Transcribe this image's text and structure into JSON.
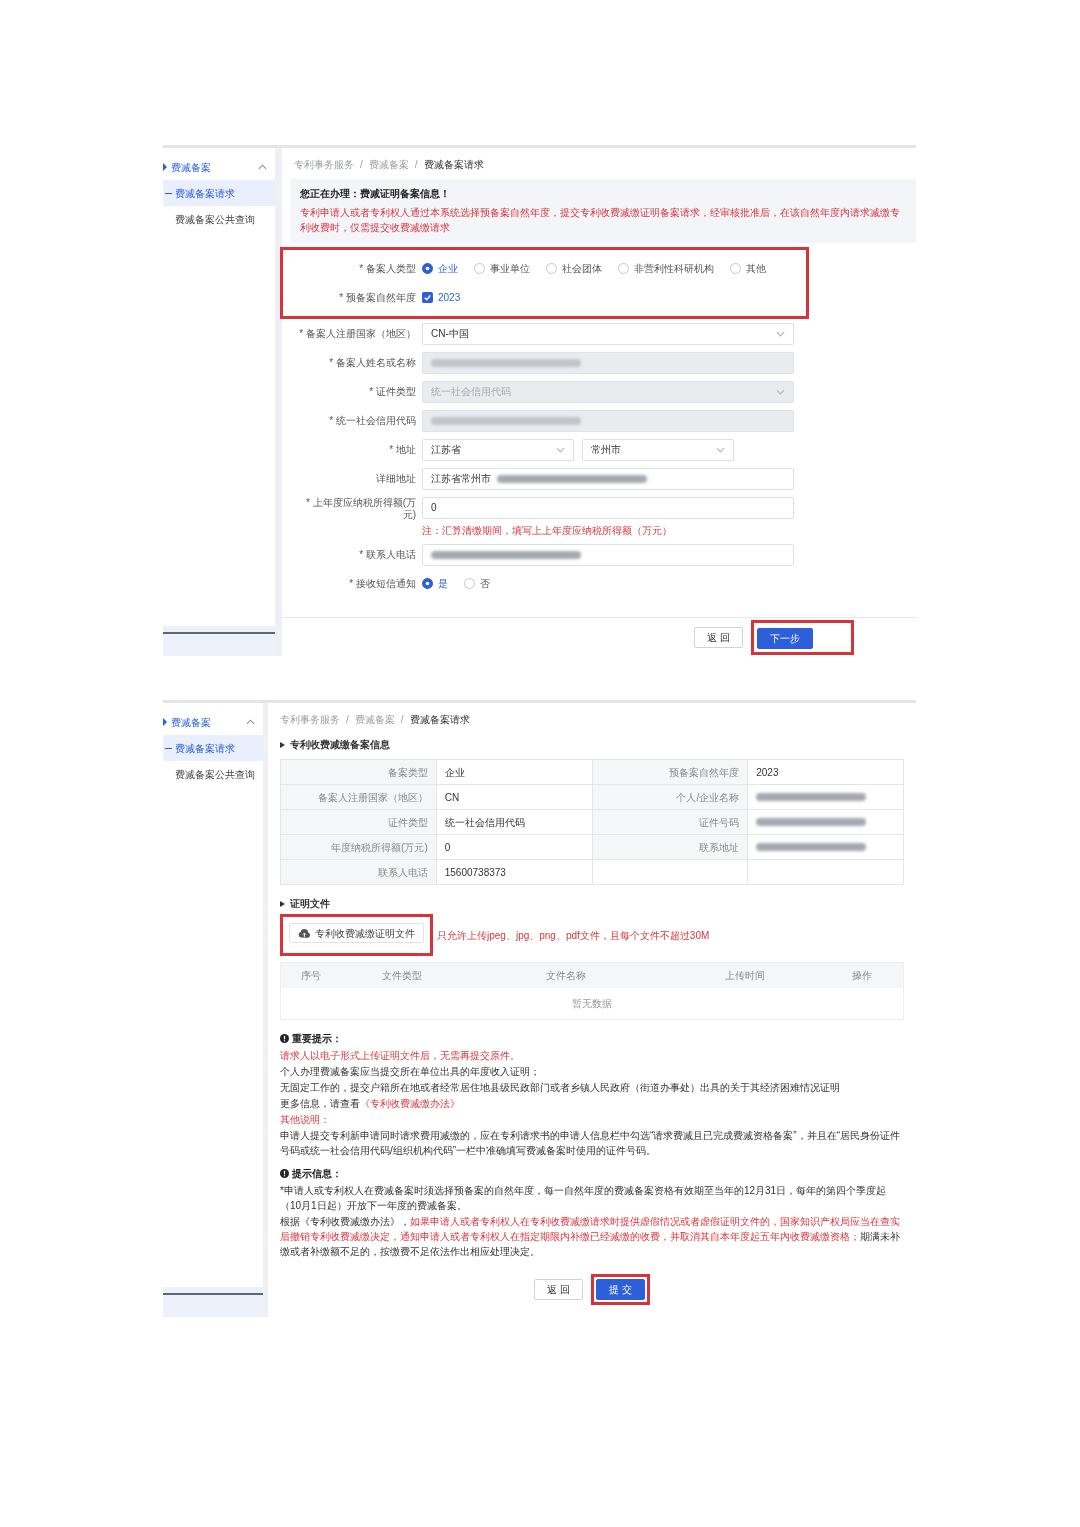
{
  "form_page": {
    "sidebar": {
      "items": [
        {
          "label": "费减备案",
          "selected": true,
          "expanded": true,
          "children": [
            {
              "label": "费减备案请求",
              "selected": true
            },
            {
              "label": "费减备案公共查询",
              "selected": false
            }
          ]
        }
      ]
    },
    "breadcrumb": {
      "separator": "/",
      "items": [
        "专利事务服务",
        "费减备案",
        "费减备案请求"
      ]
    },
    "notice": {
      "title": "您正在办理：费减证明备案信息！",
      "text": "专利申请人或者专利权人通过本系统选择预备案自然年度，提交专利收费减缴证明备案请求，经审核批准后，在该自然年度内请求减缴专利收费时，仅需提交收费减缴请求"
    },
    "fields": [
      {
        "kind": "radio",
        "label": "* 备案人类型",
        "highlighted": true,
        "options": [
          {
            "label": "企业",
            "selected": true
          },
          {
            "label": "事业单位",
            "selected": false
          },
          {
            "label": "社会团体",
            "selected": false
          },
          {
            "label": "非营利性科研机构",
            "selected": false
          },
          {
            "label": "其他",
            "selected": false
          }
        ]
      },
      {
        "kind": "checkbox",
        "label": "* 预备案自然年度",
        "highlighted": true,
        "options": [
          {
            "label": "2023",
            "checked": true
          }
        ]
      },
      {
        "kind": "select",
        "label": "* 备案人注册国家（地区）",
        "highlighted": false,
        "disabled": false,
        "value": "CN-中国"
      },
      {
        "kind": "text",
        "label": "* 备案人姓名或名称",
        "highlighted": false,
        "disabled": true,
        "redacted": true
      },
      {
        "kind": "select",
        "label": "* 证件类型",
        "highlighted": false,
        "disabled": true,
        "value": "统一社会信用代码"
      },
      {
        "kind": "text",
        "label": "* 统一社会信用代码",
        "highlighted": false,
        "disabled": true,
        "redacted": true
      },
      {
        "kind": "region",
        "label": "* 地址",
        "highlighted": false,
        "values": [
          "江苏省",
          "常州市"
        ]
      },
      {
        "kind": "text",
        "label": "详细地址",
        "highlighted": false,
        "disabled": false,
        "value": "江苏省常州市",
        "redacted": true
      },
      {
        "kind": "text",
        "label": "* 上年度应纳税所得额(万元)",
        "highlighted": false,
        "disabled": false,
        "value": "0",
        "redacted": false,
        "note": "注：汇算清缴期间，填写上上年度应纳税所得额（万元）"
      },
      {
        "kind": "text",
        "label": "* 联系人电话",
        "highlighted": false,
        "disabled": false,
        "redacted": true
      },
      {
        "kind": "radio",
        "label": "* 接收短信通知",
        "highlighted": false,
        "options": [
          {
            "label": "是",
            "selected": true
          },
          {
            "label": "否",
            "selected": false
          }
        ]
      }
    ],
    "buttons": [
      {
        "kind": "back",
        "label": "返 回",
        "highlighted": false
      },
      {
        "kind": "next",
        "label": "下一步",
        "highlighted": true
      }
    ]
  },
  "review_page": {
    "sidebar": {
      "items": [
        {
          "label": "费减备案",
          "selected": true,
          "expanded": true,
          "children": [
            {
              "label": "费减备案请求",
              "selected": true
            },
            {
              "label": "费减备案公共查询",
              "selected": false
            }
          ]
        }
      ]
    },
    "breadcrumb": {
      "separator": "/",
      "items": [
        "专利事务服务",
        "费减备案",
        "费减备案请求"
      ]
    },
    "info": {
      "title": "专利收费减缴备案信息",
      "rows": [
        [
          {
            "label": "备案类型",
            "value": "企业",
            "redacted": false
          },
          {
            "label": "预备案自然年度",
            "value": "2023",
            "redacted": false
          }
        ],
        [
          {
            "label": "备案人注册国家（地区）",
            "value": "CN",
            "redacted": false
          },
          {
            "label": "个人/企业名称",
            "redacted": true
          }
        ],
        [
          {
            "label": "证件类型",
            "value": "统一社会信用代码",
            "redacted": false
          },
          {
            "label": "证件号码",
            "redacted": true
          }
        ],
        [
          {
            "label": "年度纳税所得额(万元)",
            "value": "0",
            "redacted": false
          },
          {
            "label": "联系地址",
            "redacted": true
          }
        ],
        [
          {
            "label": "联系人电话",
            "value": "15600738373",
            "redacted": false
          }
        ]
      ]
    },
    "files": {
      "title": "证明文件",
      "upload": {
        "label": "专利收费减缴证明文件",
        "highlighted": true
      },
      "hint": "只允许上传jpeg、jpg、png、pdf文件，且每个文件不超过30M",
      "columns": [
        "序号",
        "文件类型",
        "文件名称",
        "上传时间",
        "操作"
      ],
      "empty_text": "暂无数据"
    },
    "notes": [
      {
        "title": "重要提示：",
        "paragraphs": [
          {
            "segments": [
              {
                "kind": "emphasis",
                "text": "请求人以电子形式上传证明文件后，无需再提交原件。"
              }
            ]
          },
          {
            "segments": [
              {
                "kind": "plain",
                "text": "个人办理费减备案应当提交所在单位出具的年度收入证明；"
              }
            ]
          },
          {
            "segments": [
              {
                "kind": "plain",
                "text": "无固定工作的，提交户籍所在地或者经常居住地县级民政部门或者乡镇人民政府（街道办事处）出具的关于其经济困难情况证明"
              }
            ]
          },
          {
            "segments": [
              {
                "kind": "plain",
                "text": "更多信息，请查看"
              },
              {
                "kind": "link",
                "text": "《专利收费减缴办法》"
              }
            ]
          },
          {
            "segments": [
              {
                "kind": "emphasis",
                "text": "其他说明："
              }
            ]
          },
          {
            "segments": [
              {
                "kind": "plain",
                "text": "申请人提交专利新申请同时请求费用减缴的，应在专利请求书的申请人信息栏中勾选“请求费减且已完成费减资格备案”，并且在“居民身份证件号码或统一社会信用代码/组织机构代码”一栏中准确填写费减备案时使用的证件号码。"
              }
            ]
          }
        ]
      },
      {
        "title": "提示信息：",
        "paragraphs": [
          {
            "segments": [
              {
                "kind": "plain",
                "text": "*申请人或专利权人在费减备案时须选择预备案的自然年度，每一自然年度的费减备案资格有效期至当年的12月31日，每年的第四个季度起（10月1日起）开放下一年度的费减备案。"
              }
            ]
          },
          {
            "segments": [
              {
                "kind": "plain",
                "text": "根据《专利收费减缴办法》，"
              },
              {
                "kind": "emphasis",
                "text": "如果申请人或者专利权人在专利收费减缴请求时提供虚假情况或者虚假证明文件的，国家知识产权局应当在查实后撤销专利收费减缴决定，通知申请人或者专利权人在指定期限内补缴已经减缴的收费，并取消其自本年度起五年内收费减缴资格；"
              },
              {
                "kind": "plain",
                "text": "期满未补缴或者补缴额不足的，按缴费不足依法作出相应处理决定。"
              }
            ]
          }
        ]
      }
    ],
    "buttons": [
      {
        "kind": "back",
        "label": "返 回",
        "highlighted": false
      },
      {
        "kind": "submit",
        "label": "提 交",
        "highlighted": true
      }
    ]
  }
}
